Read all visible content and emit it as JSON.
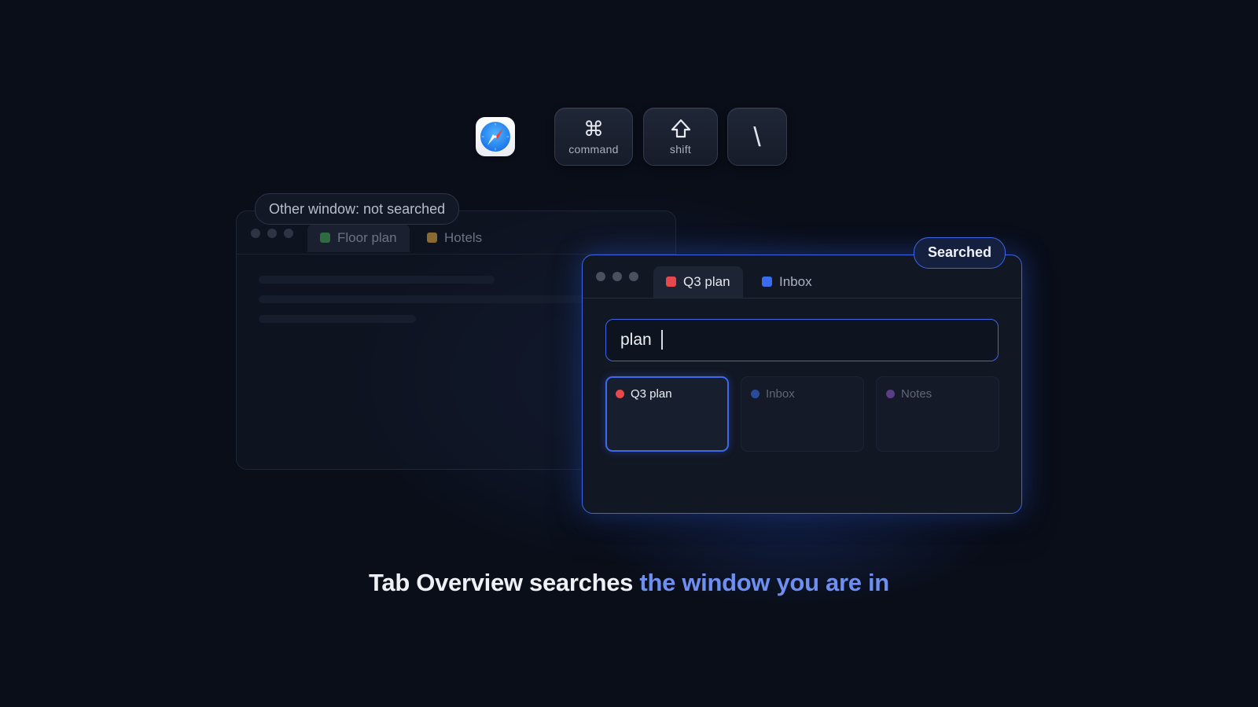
{
  "shortcut": {
    "app_icon": "compass-icon",
    "keys": [
      {
        "glyph": "⌘",
        "label": "command",
        "icon": "command-icon"
      },
      {
        "glyph": "⇧",
        "label": "shift",
        "icon": "shift-icon"
      },
      {
        "glyph": "\\",
        "label": "",
        "icon": "backslash-key"
      }
    ]
  },
  "other_window": {
    "badge": "Other window: not searched",
    "tabs": [
      {
        "label": "Floor plan",
        "color": "#2f6a40"
      },
      {
        "label": "Hotels",
        "color": "#8a6a30"
      }
    ]
  },
  "searched_window": {
    "badge": "Searched",
    "tabs": [
      {
        "label": "Q3 plan",
        "color": "#e5484d"
      },
      {
        "label": "Inbox",
        "color": "#3b6cf0"
      }
    ],
    "search": {
      "value": "plan"
    },
    "results": [
      {
        "label": "Q3 plan",
        "color": "#e5484d",
        "selected": true
      },
      {
        "label": "Inbox",
        "color": "#2c4a9a",
        "selected": false
      },
      {
        "label": "Notes",
        "color": "#5a3f86",
        "selected": false
      }
    ]
  },
  "caption": {
    "lead": "Tab Overview searches ",
    "accent": "the window you are in"
  },
  "colors": {
    "accent": "#3d66e6",
    "accent_text": "#6f8ff0",
    "background": "#0a0e19"
  }
}
